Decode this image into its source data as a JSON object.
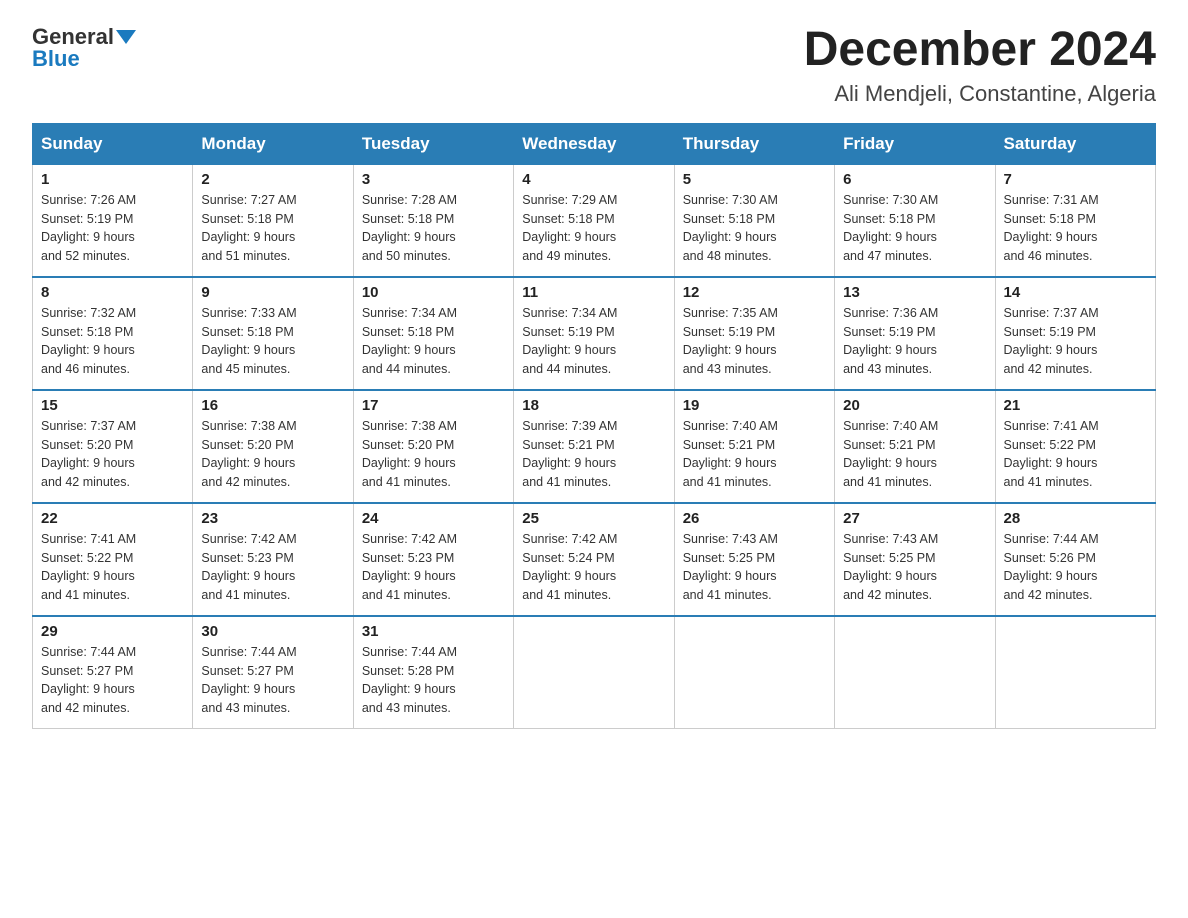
{
  "logo": {
    "general": "General",
    "blue": "Blue"
  },
  "title": "December 2024",
  "subtitle": "Ali Mendjeli, Constantine, Algeria",
  "days_of_week": [
    "Sunday",
    "Monday",
    "Tuesday",
    "Wednesday",
    "Thursday",
    "Friday",
    "Saturday"
  ],
  "weeks": [
    [
      {
        "day": "1",
        "sunrise": "7:26 AM",
        "sunset": "5:19 PM",
        "daylight": "9 hours and 52 minutes."
      },
      {
        "day": "2",
        "sunrise": "7:27 AM",
        "sunset": "5:18 PM",
        "daylight": "9 hours and 51 minutes."
      },
      {
        "day": "3",
        "sunrise": "7:28 AM",
        "sunset": "5:18 PM",
        "daylight": "9 hours and 50 minutes."
      },
      {
        "day": "4",
        "sunrise": "7:29 AM",
        "sunset": "5:18 PM",
        "daylight": "9 hours and 49 minutes."
      },
      {
        "day": "5",
        "sunrise": "7:30 AM",
        "sunset": "5:18 PM",
        "daylight": "9 hours and 48 minutes."
      },
      {
        "day": "6",
        "sunrise": "7:30 AM",
        "sunset": "5:18 PM",
        "daylight": "9 hours and 47 minutes."
      },
      {
        "day": "7",
        "sunrise": "7:31 AM",
        "sunset": "5:18 PM",
        "daylight": "9 hours and 46 minutes."
      }
    ],
    [
      {
        "day": "8",
        "sunrise": "7:32 AM",
        "sunset": "5:18 PM",
        "daylight": "9 hours and 46 minutes."
      },
      {
        "day": "9",
        "sunrise": "7:33 AM",
        "sunset": "5:18 PM",
        "daylight": "9 hours and 45 minutes."
      },
      {
        "day": "10",
        "sunrise": "7:34 AM",
        "sunset": "5:18 PM",
        "daylight": "9 hours and 44 minutes."
      },
      {
        "day": "11",
        "sunrise": "7:34 AM",
        "sunset": "5:19 PM",
        "daylight": "9 hours and 44 minutes."
      },
      {
        "day": "12",
        "sunrise": "7:35 AM",
        "sunset": "5:19 PM",
        "daylight": "9 hours and 43 minutes."
      },
      {
        "day": "13",
        "sunrise": "7:36 AM",
        "sunset": "5:19 PM",
        "daylight": "9 hours and 43 minutes."
      },
      {
        "day": "14",
        "sunrise": "7:37 AM",
        "sunset": "5:19 PM",
        "daylight": "9 hours and 42 minutes."
      }
    ],
    [
      {
        "day": "15",
        "sunrise": "7:37 AM",
        "sunset": "5:20 PM",
        "daylight": "9 hours and 42 minutes."
      },
      {
        "day": "16",
        "sunrise": "7:38 AM",
        "sunset": "5:20 PM",
        "daylight": "9 hours and 42 minutes."
      },
      {
        "day": "17",
        "sunrise": "7:38 AM",
        "sunset": "5:20 PM",
        "daylight": "9 hours and 41 minutes."
      },
      {
        "day": "18",
        "sunrise": "7:39 AM",
        "sunset": "5:21 PM",
        "daylight": "9 hours and 41 minutes."
      },
      {
        "day": "19",
        "sunrise": "7:40 AM",
        "sunset": "5:21 PM",
        "daylight": "9 hours and 41 minutes."
      },
      {
        "day": "20",
        "sunrise": "7:40 AM",
        "sunset": "5:21 PM",
        "daylight": "9 hours and 41 minutes."
      },
      {
        "day": "21",
        "sunrise": "7:41 AM",
        "sunset": "5:22 PM",
        "daylight": "9 hours and 41 minutes."
      }
    ],
    [
      {
        "day": "22",
        "sunrise": "7:41 AM",
        "sunset": "5:22 PM",
        "daylight": "9 hours and 41 minutes."
      },
      {
        "day": "23",
        "sunrise": "7:42 AM",
        "sunset": "5:23 PM",
        "daylight": "9 hours and 41 minutes."
      },
      {
        "day": "24",
        "sunrise": "7:42 AM",
        "sunset": "5:23 PM",
        "daylight": "9 hours and 41 minutes."
      },
      {
        "day": "25",
        "sunrise": "7:42 AM",
        "sunset": "5:24 PM",
        "daylight": "9 hours and 41 minutes."
      },
      {
        "day": "26",
        "sunrise": "7:43 AM",
        "sunset": "5:25 PM",
        "daylight": "9 hours and 41 minutes."
      },
      {
        "day": "27",
        "sunrise": "7:43 AM",
        "sunset": "5:25 PM",
        "daylight": "9 hours and 42 minutes."
      },
      {
        "day": "28",
        "sunrise": "7:44 AM",
        "sunset": "5:26 PM",
        "daylight": "9 hours and 42 minutes."
      }
    ],
    [
      {
        "day": "29",
        "sunrise": "7:44 AM",
        "sunset": "5:27 PM",
        "daylight": "9 hours and 42 minutes."
      },
      {
        "day": "30",
        "sunrise": "7:44 AM",
        "sunset": "5:27 PM",
        "daylight": "9 hours and 43 minutes."
      },
      {
        "day": "31",
        "sunrise": "7:44 AM",
        "sunset": "5:28 PM",
        "daylight": "9 hours and 43 minutes."
      },
      null,
      null,
      null,
      null
    ]
  ],
  "labels": {
    "sunrise": "Sunrise:",
    "sunset": "Sunset:",
    "daylight": "Daylight:"
  }
}
